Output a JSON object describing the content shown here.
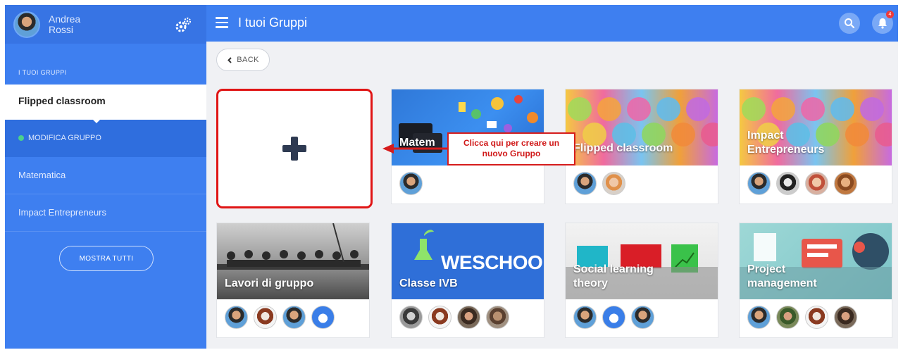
{
  "user": {
    "first_name": "Andrea",
    "last_name": "Rossi"
  },
  "topbar": {
    "title": "I tuoi Gruppi",
    "notification_count": "4"
  },
  "sidebar": {
    "section_label": "I TUOI GRUPPI",
    "active_group": "Flipped classroom",
    "edit_label": "MODIFICA GRUPPO",
    "items": [
      {
        "label": "Matematica"
      },
      {
        "label": "Impact Entrepreneurs"
      }
    ],
    "show_all": "MOSTRA TUTTI"
  },
  "back_label": "BACK",
  "callout": {
    "line1": "Clicca qui per creare un",
    "line2": "nuovo Gruppo"
  },
  "groups": [
    {
      "title": "Matem",
      "members": 1
    },
    {
      "title": "Flipped classroom",
      "members": 2
    },
    {
      "title_line1": "Impact",
      "title_line2": "Entrepreneurs",
      "members": 4
    },
    {
      "title": "Lavori di gruppo",
      "members": 4
    },
    {
      "title": "Classe IVB",
      "banner": "WESCHOO",
      "members": 4
    },
    {
      "title_line1": "Social learning",
      "title_line2": "theory",
      "members": 3
    },
    {
      "title_line1": "Project",
      "title_line2": "management",
      "members": 4
    }
  ],
  "colors": {
    "primary": "#3e7ff0",
    "sidebar_dark": "#2f6ede",
    "callout_red": "#d61c1c",
    "add_icon": "#2e3a52"
  }
}
